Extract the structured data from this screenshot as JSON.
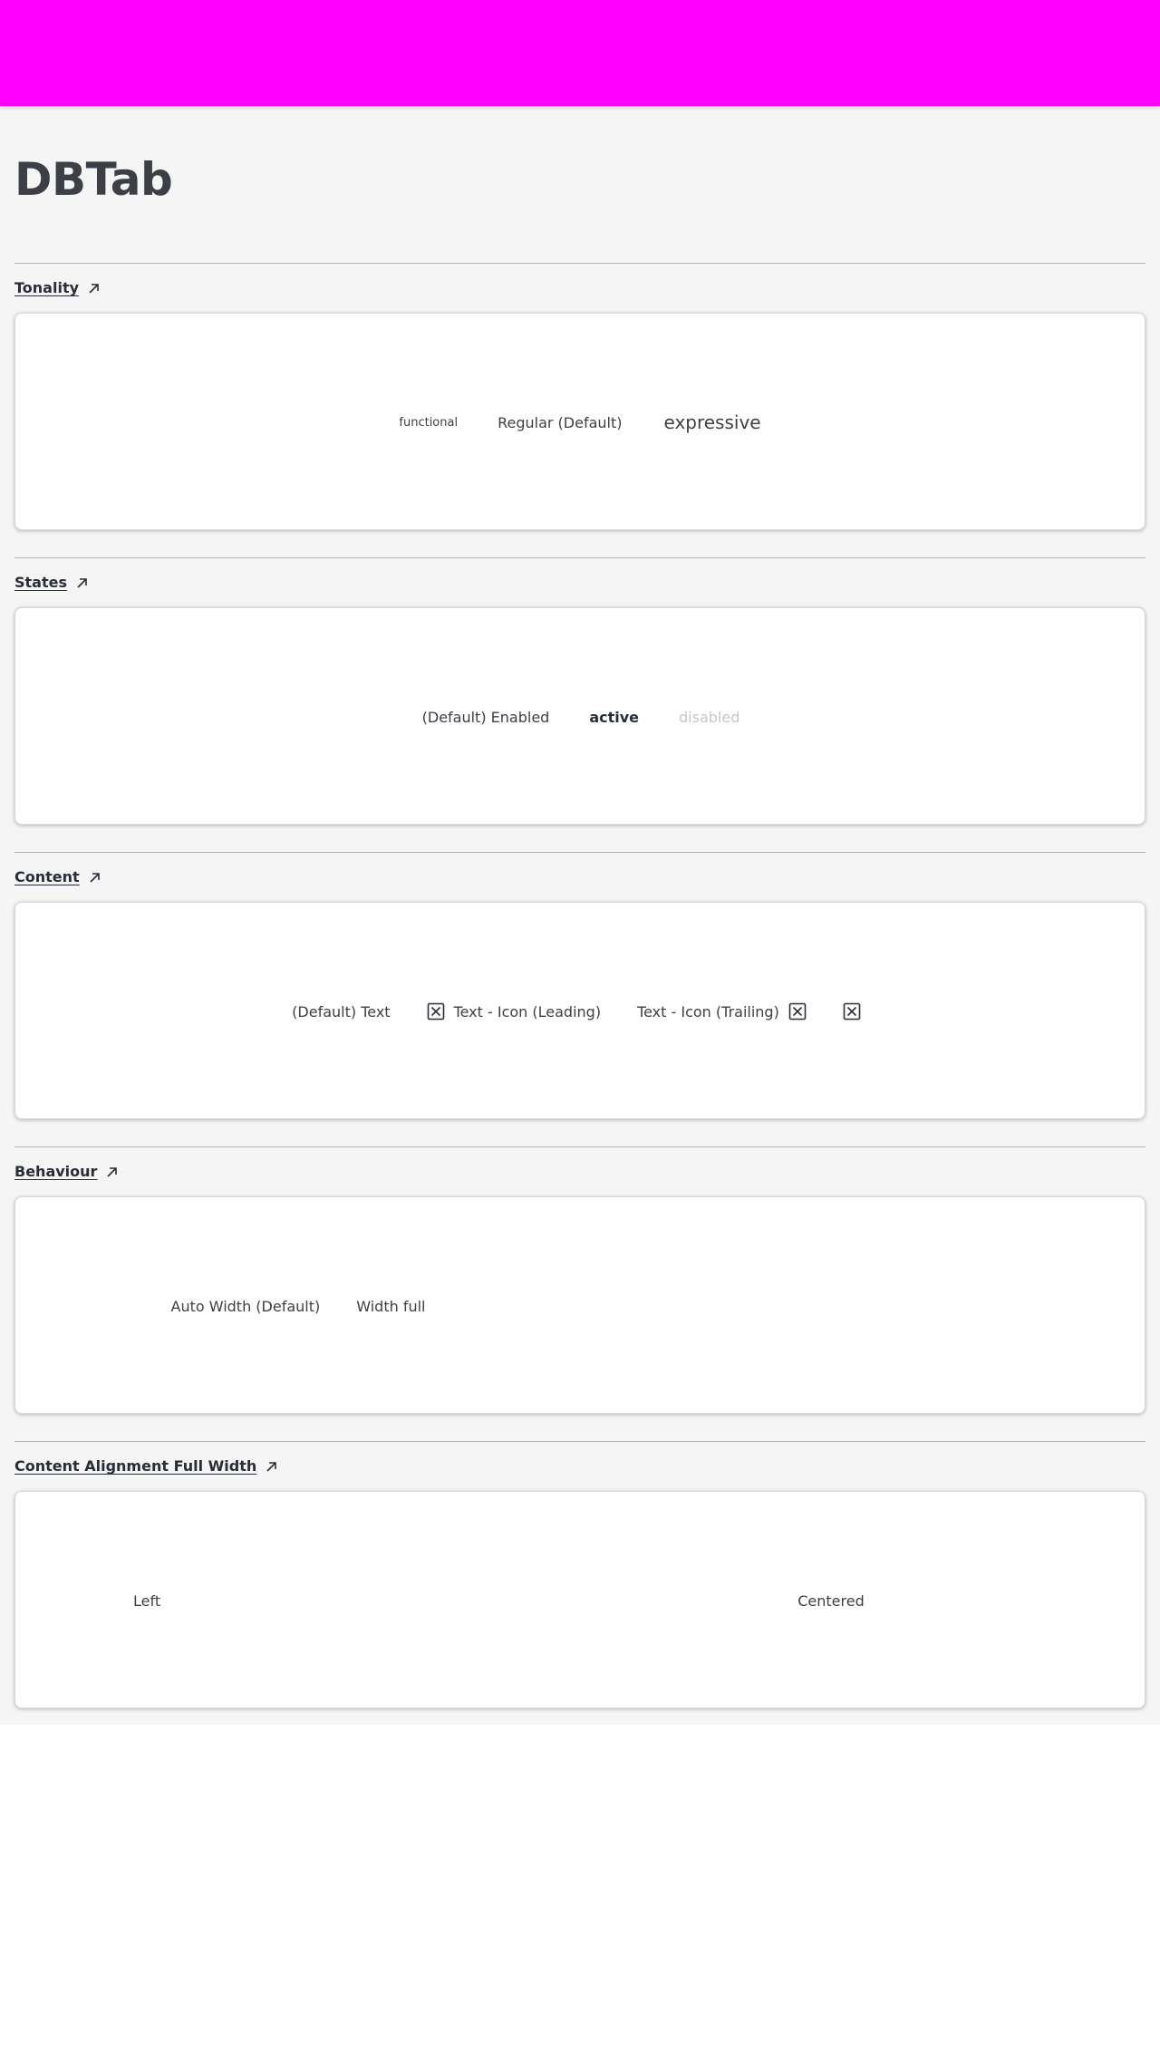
{
  "header": {
    "color": "#ff00ff"
  },
  "page_title": "DBTab",
  "sections": [
    {
      "title": "Tonality",
      "items": [
        {
          "label": "functional"
        },
        {
          "label": "Regular (Default)"
        },
        {
          "label": "expressive"
        }
      ]
    },
    {
      "title": "States",
      "items": [
        {
          "label": "(Default) Enabled"
        },
        {
          "label": "active"
        },
        {
          "label": "disabled"
        }
      ]
    },
    {
      "title": "Content",
      "items": [
        {
          "label": "(Default) Text"
        },
        {
          "label": "Text - Icon (Leading)",
          "icon": "x-square-icon"
        },
        {
          "label": "Text - Icon (Trailing)",
          "icon": "x-square-icon"
        },
        {
          "label": "",
          "icon": "x-square-icon"
        }
      ]
    },
    {
      "title": "Behaviour",
      "items": [
        {
          "label": "Auto Width (Default)"
        },
        {
          "label": "Width full"
        }
      ]
    },
    {
      "title": "Content Alignment Full Width",
      "items": [
        {
          "label": "Left"
        },
        {
          "label": "Centered"
        }
      ]
    }
  ]
}
